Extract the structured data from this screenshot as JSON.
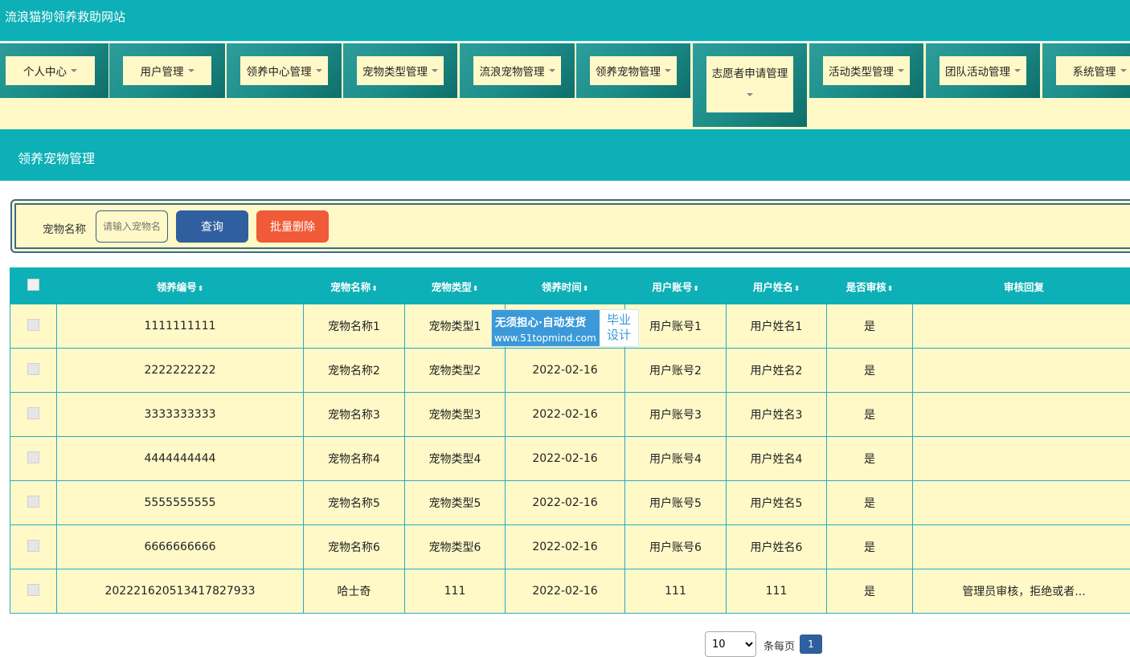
{
  "app": {
    "title": "流浪猫狗领养救助网站"
  },
  "nav": {
    "items": [
      {
        "label": "个人中心"
      },
      {
        "label": "用户管理"
      },
      {
        "label": "领养中心管理"
      },
      {
        "label": "宠物类型管理"
      },
      {
        "label": "流浪宠物管理"
      },
      {
        "label": "领养宠物管理"
      },
      {
        "label": "志愿者申请管理"
      },
      {
        "label": "活动类型管理"
      },
      {
        "label": "团队活动管理"
      },
      {
        "label": "系统管理"
      }
    ]
  },
  "section": {
    "title": "领养宠物管理"
  },
  "search": {
    "label": "宠物名称",
    "placeholder": "请输入宠物名称",
    "query_label": "查询",
    "batch_delete_label": "批量删除"
  },
  "table": {
    "headers": [
      "领养编号",
      "宠物名称",
      "宠物类型",
      "领养时间",
      "用户账号",
      "用户姓名",
      "是否审核",
      "审核回复"
    ],
    "rows": [
      [
        "1111111111",
        "宠物名称1",
        "宠物类型1",
        "",
        "用户账号1",
        "用户姓名1",
        "是",
        ""
      ],
      [
        "2222222222",
        "宠物名称2",
        "宠物类型2",
        "2022-02-16",
        "用户账号2",
        "用户姓名2",
        "是",
        ""
      ],
      [
        "3333333333",
        "宠物名称3",
        "宠物类型3",
        "2022-02-16",
        "用户账号3",
        "用户姓名3",
        "是",
        ""
      ],
      [
        "4444444444",
        "宠物名称4",
        "宠物类型4",
        "2022-02-16",
        "用户账号4",
        "用户姓名4",
        "是",
        ""
      ],
      [
        "5555555555",
        "宠物名称5",
        "宠物类型5",
        "2022-02-16",
        "用户账号5",
        "用户姓名5",
        "是",
        ""
      ],
      [
        "6666666666",
        "宠物名称6",
        "宠物类型6",
        "2022-02-16",
        "用户账号6",
        "用户姓名6",
        "是",
        ""
      ],
      [
        "202221620513417827933",
        "哈士奇",
        "111",
        "2022-02-16",
        "111",
        "111",
        "是",
        "管理员审核，拒绝或者..."
      ]
    ]
  },
  "pagination": {
    "page_size": "10",
    "per_page_label": "条每页",
    "current_page": "1"
  },
  "watermark": {
    "text": "无须担心·自动发货",
    "url": "www.51topmind.com",
    "badge_line1": "毕业",
    "badge_line2": "设计"
  },
  "colors": {
    "primary": "#0cb0b6",
    "nav_bg": "#fff9c8",
    "query_button": "#2f5f9e",
    "delete_button": "#f05a38"
  }
}
